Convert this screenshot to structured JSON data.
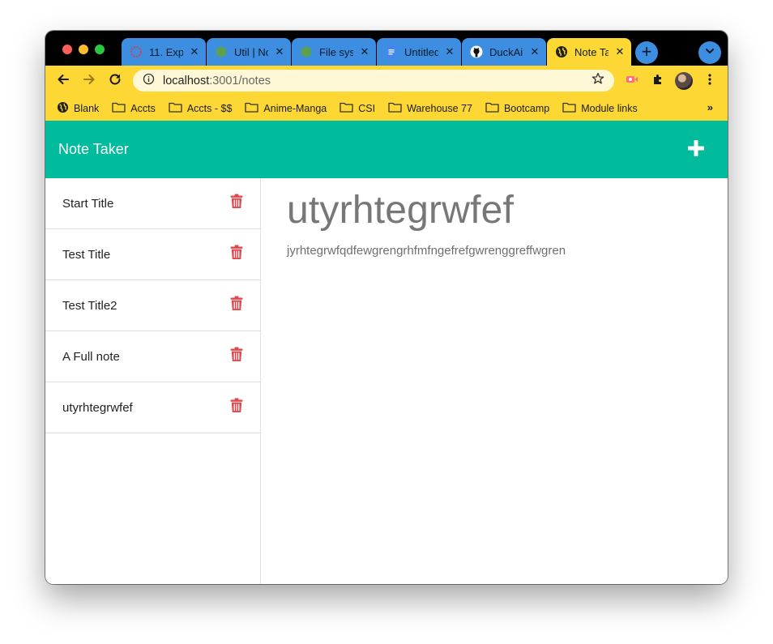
{
  "browser": {
    "tabs": [
      {
        "title": "11. Exp",
        "icon": "loading-ring-icon"
      },
      {
        "title": "Util | Node",
        "icon": "nodejs-icon"
      },
      {
        "title": "File sys",
        "icon": "nodejs-icon"
      },
      {
        "title": "Untitled",
        "icon": "docs-icon"
      },
      {
        "title": "DuckAi",
        "icon": "github-icon"
      },
      {
        "title": "Note Taker",
        "icon": "globe-icon"
      }
    ],
    "new_tab_label": "+",
    "url_host": "localhost",
    "url_path": ":3001/notes",
    "bookmarks": [
      {
        "label": "Blank",
        "icon": "globe-icon"
      },
      {
        "label": "Accts",
        "icon": "folder-icon"
      },
      {
        "label": "Accts - $$",
        "icon": "folder-icon"
      },
      {
        "label": "Anime-Manga",
        "icon": "folder-icon"
      },
      {
        "label": "CSI",
        "icon": "folder-icon"
      },
      {
        "label": "Warehouse 77",
        "icon": "folder-icon"
      },
      {
        "label": "Bootcamp",
        "icon": "folder-icon"
      },
      {
        "label": "Module links",
        "icon": "folder-icon"
      }
    ],
    "bookmarks_more": "»"
  },
  "app": {
    "brand": "Note Taker",
    "notes": [
      {
        "title": "Start Title"
      },
      {
        "title": "Test Title"
      },
      {
        "title": "Test Title2"
      },
      {
        "title": "A Full note"
      },
      {
        "title": "utyrhtegrwfef"
      }
    ],
    "active_note": {
      "title": "utyrhtegrwfef",
      "text": "jyrhtegrwfqdfewgrengrhfmfngefrefgwrenggreffwgren"
    }
  },
  "colors": {
    "header": "#00bb9c",
    "browser_accent": "#fdd835",
    "tab_blue": "#3d8ee0",
    "trash": "#e0474c"
  }
}
